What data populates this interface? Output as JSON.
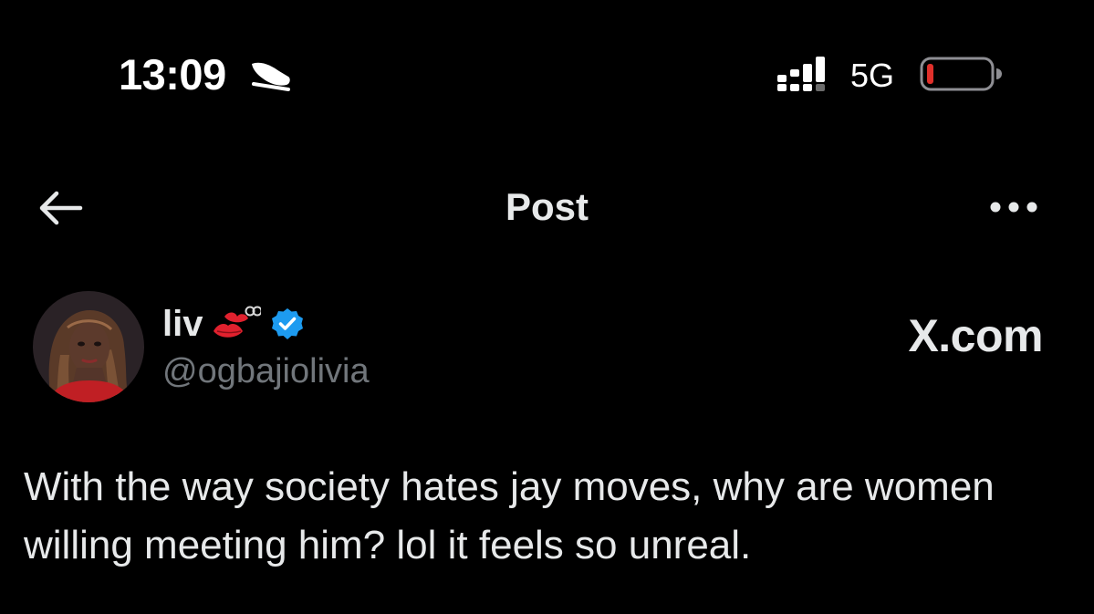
{
  "status_bar": {
    "time": "13:09",
    "focus_icon": "sleep-focus-icon",
    "signal_icon": "cellular-signal-icon",
    "network": "5G",
    "battery_icon": "battery-low-icon",
    "battery_color": "#e0302b"
  },
  "nav": {
    "back_icon": "back-arrow-icon",
    "title": "Post",
    "more_icon": "more-horizontal-icon"
  },
  "post": {
    "author": {
      "display_name": "liv",
      "name_emojis": "lips-kiss-emoji",
      "verified": true,
      "verified_color": "#1d9bf0",
      "handle": "@ogbajiolivia"
    },
    "watermark": "X.com",
    "text": "With the way society hates jay moves, why are women willing meeting him? lol it feels so unreal."
  }
}
